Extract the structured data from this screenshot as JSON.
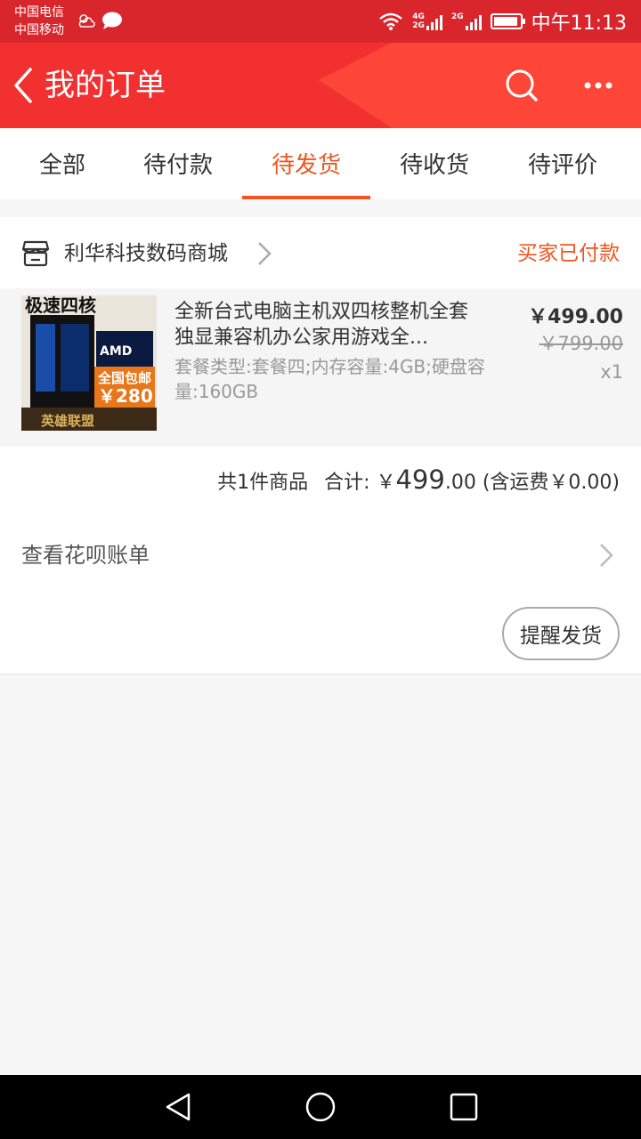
{
  "status_bar": {
    "carrier_1": "中国电信",
    "carrier_2": "中国移动",
    "net_4g": "4G",
    "net_2g": "2G",
    "net_2g_b": "2G",
    "time": "中午11:13"
  },
  "header": {
    "title": "我的订单",
    "bg_color": "#f23030"
  },
  "tabs": [
    {
      "label": "全部",
      "active": false
    },
    {
      "label": "待付款",
      "active": false
    },
    {
      "label": "待发货",
      "active": true
    },
    {
      "label": "待收货",
      "active": false
    },
    {
      "label": "待评价",
      "active": false
    }
  ],
  "order": {
    "shop_name": "利华科技数码商城",
    "status": "买家已付款",
    "item": {
      "title": "全新台式电脑主机双四核整机全套独显兼容机办公家用游戏全...",
      "sku": "套餐类型:套餐四;内存容量:4GB;硬盘容量:160GB",
      "price": "￥499.00",
      "original_price": "￥799.00",
      "quantity": "x1",
      "thumbnail": {
        "text_top": "极速四核",
        "badge": "AMD",
        "promo": "全国包邮",
        "promo_price": "￥280",
        "bottom_text": "英雄联盟"
      }
    },
    "summary": {
      "count": "共1件商品",
      "total_label": "合计: ￥",
      "total_int": "499",
      "total_dec": ".00",
      "shipping": "(含运费￥0.00)"
    },
    "huabei_label": "查看花呗账单",
    "remind_button": "提醒发货"
  },
  "colors": {
    "accent": "#f0561e",
    "status_bar": "#d8262c"
  }
}
